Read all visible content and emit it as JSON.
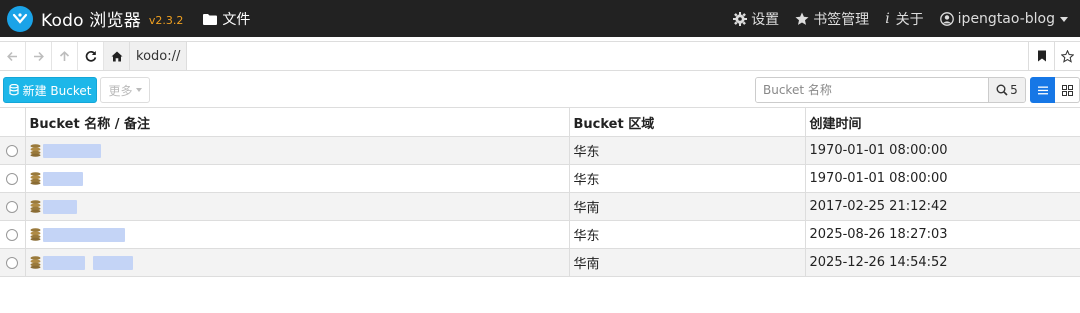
{
  "app": {
    "name": "Kodo 浏览器",
    "version": "v2.3.2",
    "nav_files": "文件",
    "nav_right": [
      {
        "key": "settings",
        "label": "设置",
        "icon": "gear-icon"
      },
      {
        "key": "bookmarks",
        "label": "书签管理",
        "icon": "star-icon"
      },
      {
        "key": "about",
        "label": "关于",
        "icon": "info-icon"
      },
      {
        "key": "user",
        "label": "ipengtao-blog",
        "icon": "user-icon"
      }
    ]
  },
  "address": {
    "prefix": "kodo://",
    "value": ""
  },
  "toolbar": {
    "new_bucket": "新建 Bucket",
    "more": "更多",
    "search_placeholder": "Bucket 名称",
    "search_count": "5"
  },
  "table": {
    "columns": [
      "Bucket 名称 / 备注",
      "Bucket 区域",
      "创建时间"
    ],
    "rows": [
      {
        "region": "华东",
        "created": "1970-01-01 08:00:00"
      },
      {
        "region": "华东",
        "created": "1970-01-01 08:00:00"
      },
      {
        "region": "华南",
        "created": "2017-02-25 21:12:42"
      },
      {
        "region": "华东",
        "created": "2025-08-26 18:27:03"
      },
      {
        "region": "华南",
        "created": "2025-12-26 14:54:52"
      }
    ]
  },
  "colors": {
    "navbar": "#222222",
    "accent_cyan": "#1db7e9",
    "accent_blue": "#1677e6",
    "version": "#f0a020"
  }
}
